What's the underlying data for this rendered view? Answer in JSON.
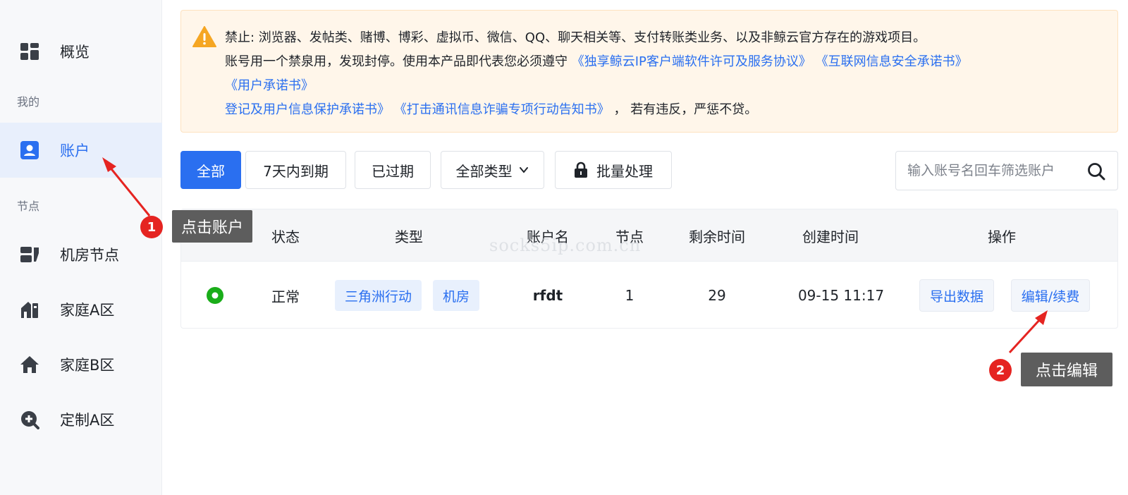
{
  "sidebar": {
    "items": [
      {
        "label": "概览",
        "icon": "dashboard-grid-icon"
      },
      {
        "label": "账户",
        "icon": "account-card-icon",
        "active": true
      },
      {
        "label": "机房节点",
        "icon": "server-room-icon"
      },
      {
        "label": "家庭A区",
        "icon": "home-building-icon"
      },
      {
        "label": "家庭B区",
        "icon": "house-icon"
      },
      {
        "label": "定制A区",
        "icon": "custom-plus-icon"
      }
    ],
    "sections": {
      "mine": "我的",
      "nodes": "节点"
    }
  },
  "notice": {
    "line1": "禁止: 浏览器、发帖类、赌博、博彩、虚拟币、微信、QQ、聊天相关等、支付转账类业务、以及非鲸云官方存在的游戏项目。",
    "line2_text": "账号用一个禁泉用，发现封停。使用本产品即代表您必须遵守",
    "link_license": "《独享鲸云IP客户端软件许可及服务协议》",
    "link_security": "《互联网信息安全承诺书》",
    "link_user_promise": "《用户承诺书》",
    "link_register": "登记及用户信息保护承诺书》",
    "link_fraud": "《打击通讯信息诈骗专项行动告知书》",
    "line4_tail": "， 若有违反，严惩不贷。"
  },
  "toolbar": {
    "filter_all": "全部",
    "filter_7days": "7天内到期",
    "filter_expired": "已过期",
    "type_select": "全部类型",
    "batch_label": "批量处理"
  },
  "search": {
    "placeholder": "输入账号名回车筛选账户"
  },
  "table": {
    "headers": [
      "状态",
      "类型",
      "账户名",
      "节点",
      "剩余时间",
      "创建时间",
      "操作"
    ],
    "rows": [
      {
        "status": "正常",
        "type_game": "三角洲行动",
        "type_room": "机房",
        "account_name": "rfdt",
        "nodes": "1",
        "remaining": "29",
        "created": "09-15 11:17",
        "action_export": "导出数据",
        "action_edit": "编辑/续费"
      }
    ]
  },
  "watermark": "socks5ip.com.cn",
  "annotations": {
    "step1_num": "1",
    "step1_text": "点击账户",
    "step2_num": "2",
    "step2_text": "点击编辑"
  },
  "colors": {
    "accent": "#2a6ff0",
    "warning": "#f5a623",
    "status_ok": "#1aad19",
    "annotation_red": "#e52421"
  }
}
